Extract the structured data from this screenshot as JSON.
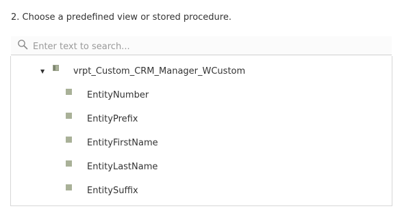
{
  "instruction": "2. Choose a predefined view or stored procedure.",
  "search": {
    "placeholder": "Enter text to search...",
    "value": "",
    "icon": "search-icon"
  },
  "tree": {
    "root": {
      "label": "vrpt_Custom_CRM_Manager_WCustom",
      "expanded": true,
      "icon": "view-node-icon"
    },
    "children": [
      {
        "label": "EntityNumber"
      },
      {
        "label": "EntityPrefix"
      },
      {
        "label": "EntityFirstName"
      },
      {
        "label": "EntityLastName"
      },
      {
        "label": "EntitySuffix"
      }
    ]
  },
  "colors": {
    "node_icon": "#a9b198",
    "border": "#d6d6d6",
    "text": "#333333",
    "placeholder": "#9a9a9a"
  }
}
